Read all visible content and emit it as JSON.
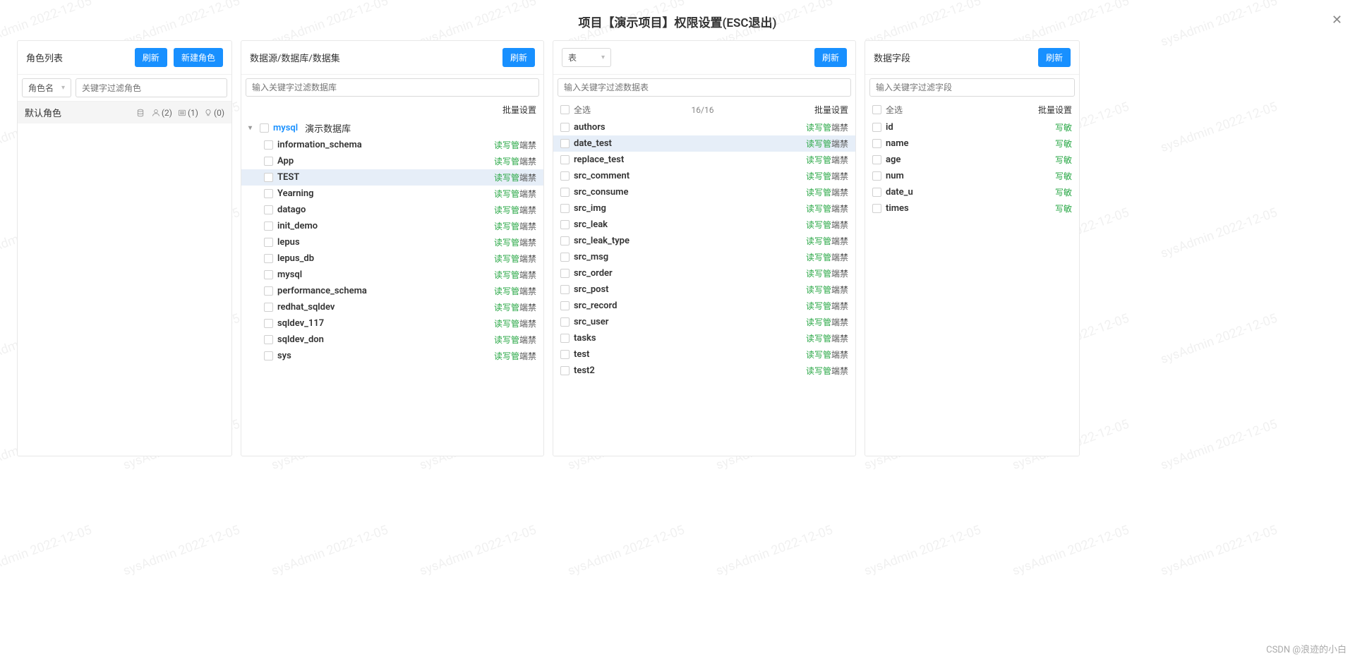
{
  "watermark_text": "sysAdmin 2022-12-05",
  "title": "项目【演示项目】权限设置(ESC退出)",
  "attribution": "CSDN @浪迹的小白",
  "buttons": {
    "refresh": "刷新",
    "new_role": "新建角色"
  },
  "roles_panel": {
    "title": "角色列表",
    "select_label": "角色名",
    "filter_placeholder": "关键字过滤角色",
    "role": {
      "name": "默认角色",
      "icon_counts": {
        "a": "",
        "b": "(2)",
        "c": "(1)",
        "d": "(0)"
      }
    }
  },
  "datasource_panel": {
    "title": "数据源/数据库/数据集",
    "filter_placeholder": "输入关键字过滤数据库",
    "batch": "批量设置",
    "root": {
      "label": "mysql",
      "suffix": "演示数据库"
    },
    "items": [
      {
        "name": "information_schema",
        "perm": "rwmd",
        "selected": false
      },
      {
        "name": "App",
        "perm": "rwmd",
        "selected": false
      },
      {
        "name": "TEST",
        "perm": "rwmd",
        "selected": true
      },
      {
        "name": "Yearning",
        "perm": "rwmd",
        "selected": false
      },
      {
        "name": "datago",
        "perm": "rwmd",
        "selected": false
      },
      {
        "name": "init_demo",
        "perm": "rwmd",
        "selected": false
      },
      {
        "name": "lepus",
        "perm": "rwmd",
        "selected": false
      },
      {
        "name": "lepus_db",
        "perm": "rwmd",
        "selected": false
      },
      {
        "name": "mysql",
        "perm": "rwmd",
        "selected": false
      },
      {
        "name": "performance_schema",
        "perm": "rwmd",
        "selected": false
      },
      {
        "name": "redhat_sqldev",
        "perm": "rwmd",
        "selected": false
      },
      {
        "name": "sqldev_117",
        "perm": "rwmd",
        "selected": false
      },
      {
        "name": "sqldev_don",
        "perm": "rwmd",
        "selected": false
      },
      {
        "name": "sys",
        "perm": "rwmd",
        "selected": false
      }
    ]
  },
  "tables_panel": {
    "select_label": "表",
    "filter_placeholder": "输入关键字过滤数据表",
    "select_all": "全选",
    "count": "16/16",
    "batch": "批量设置",
    "items": [
      {
        "name": "authors",
        "perm": "rwmd",
        "selected": false
      },
      {
        "name": "date_test",
        "perm": "rwmd",
        "selected": true
      },
      {
        "name": "replace_test",
        "perm": "rwmd",
        "selected": false
      },
      {
        "name": "src_comment",
        "perm": "rwmd",
        "selected": false
      },
      {
        "name": "src_consume",
        "perm": "rwmd",
        "selected": false
      },
      {
        "name": "src_img",
        "perm": "rwmd",
        "selected": false
      },
      {
        "name": "src_leak",
        "perm": "rwmd",
        "selected": false
      },
      {
        "name": "src_leak_type",
        "perm": "rwmd",
        "selected": false
      },
      {
        "name": "src_msg",
        "perm": "rwmd",
        "selected": false
      },
      {
        "name": "src_order",
        "perm": "rwmd",
        "selected": false
      },
      {
        "name": "src_post",
        "perm": "rwmd",
        "selected": false
      },
      {
        "name": "src_record",
        "perm": "rwmd",
        "selected": false
      },
      {
        "name": "src_user",
        "perm": "rwmd",
        "selected": false
      },
      {
        "name": "tasks",
        "perm": "rwmd",
        "selected": false
      },
      {
        "name": "test",
        "perm": "rwmd",
        "selected": false
      },
      {
        "name": "test2",
        "perm": "rwmd",
        "selected": false
      }
    ]
  },
  "fields_panel": {
    "title": "数据字段",
    "filter_placeholder": "输入关键字过滤字段",
    "select_all": "全选",
    "batch": "批量设置",
    "items": [
      {
        "name": "id",
        "perm": "写敏"
      },
      {
        "name": "name",
        "perm": "写敏"
      },
      {
        "name": "age",
        "perm": "写敏"
      },
      {
        "name": "num",
        "perm": "写敏"
      },
      {
        "name": "date_u",
        "perm": "写敏"
      },
      {
        "name": "times",
        "perm": "写敏"
      }
    ]
  },
  "perm_labels": {
    "rwm": "读写管",
    "deny": "端禁"
  }
}
